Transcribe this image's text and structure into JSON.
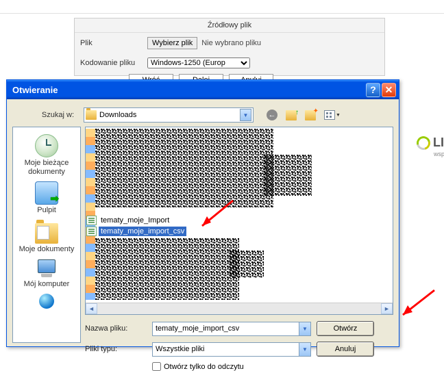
{
  "bg_panel": {
    "header": "Źródłowy plik",
    "row_file_label": "Plik",
    "choose_button": "Wybierz plik",
    "no_file_text": "Nie wybrano pliku",
    "row_encoding_label": "Kodowanie pliku",
    "encoding_value": "Windows-1250 (Europ"
  },
  "bg_buttons": {
    "back": "Wróć",
    "next": "Dalej",
    "cancel": "Anuluj"
  },
  "logo": {
    "text": "LI",
    "sub": "wsp"
  },
  "dialog": {
    "title": "Otwieranie",
    "lookin_label": "Szukaj w:",
    "lookin_value": "Downloads",
    "sidebar": {
      "recent": "Moje bieżące dokumenty",
      "desktop": "Pulpit",
      "mydocs": "Moje dokumenty",
      "mycomp": "Mój komputer"
    },
    "files": {
      "item1": "tematy_moje_Import",
      "item2": "tematy_moje_import_csv"
    },
    "filename_label": "Nazwa pliku:",
    "filename_value": "tematy_moje_import_csv",
    "filetype_label": "Pliki typu:",
    "filetype_value": "Wszystkie pliki",
    "open_btn": "Otwórz",
    "cancel_btn": "Anuluj",
    "readonly_label": "Otwórz tylko do odczytu"
  }
}
